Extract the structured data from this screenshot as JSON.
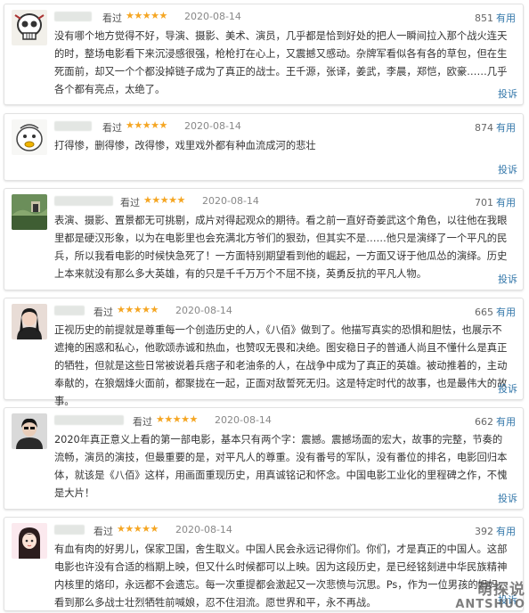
{
  "reviews": [
    {
      "seen": "看过",
      "stars": "★★★★★",
      "date": "2020-08-14",
      "votes": "851",
      "useful": "有用",
      "text": "没有哪个地方觉得不好，导演、摄影、美术、演员，几乎都是恰到好处的把人一瞬间拉入那个战火连天的时，整场电影看下来沉浸感很强，枪枪打在心上，又震撼又感动。杂牌军看似各有各的草包，但在生死面前，却又一个个都没掉链子成为了真正的战士。王千源，张译，姜武，李晨，郑恺，欧豪……几乎各个都有亮点，太绝了。",
      "report": "投诉"
    },
    {
      "seen": "看过",
      "stars": "★★★★★",
      "date": "2020-08-14",
      "votes": "874",
      "useful": "有用",
      "text": "打得惨，删得惨，改得惨，戏里戏外都有种血流成河的悲壮",
      "report": "投诉"
    },
    {
      "seen": "看过",
      "stars": "★★★★★",
      "date": "2020-08-14",
      "votes": "701",
      "useful": "有用",
      "text": "表演、摄影、置景都无可挑剔，成片对得起观众的期待。看之前一直好奇姜武这个角色，以往他在我眼里都是硬汉形象，以为在电影里也会充满北方爷们的狠劲，但其实不是……他只是演绎了一个平凡的民兵，所以我看电影的时候快急死了！一方面特别期望看到他的崛起，一方面又讶于他瓜怂的演绎。历史上本来就没有那么多大英雄，有的只是千千万万个不屈不挠，英勇反抗的平凡人物。",
      "report": "投诉"
    },
    {
      "seen": "看过",
      "stars": "★★★★★",
      "date": "2020-08-14",
      "votes": "665",
      "useful": "有用",
      "text": "正视历史的前提就是尊重每一个创造历史的人，《八佰》做到了。他描写真实的恐惧和胆怯，也展示不遮掩的困惑和私心，他歌颂赤诚和热血，也赞叹无畏和决绝。图安稳日子的普通人尚且不懂什么是真正的牺牲，但就是这些日常被说着兵痞子和老油条的人，在战争中成为了真正的英雄。被动推着的，主动奉献的，在狼烟烽火面前，都聚拢在一起，正面对敌誓死无归。这是特定时代的故事，也是最伟大的故事。",
      "report": "投诉"
    },
    {
      "seen": "看过",
      "stars": "★★★★★",
      "date": "2020-08-14",
      "votes": "662",
      "useful": "有用",
      "text": "2020年真正意义上看的第一部电影，基本只有两个字：震撼。震撼场面的宏大，故事的完整，节奏的流畅，演员的演技，但最重要的是，对平凡人的尊重。没有番号的军队，没有番位的排名，电影回归本体，就该是《八佰》这样，用画面重现历史，用真诚铭记和怀念。中国电影工业化的里程碑之作，不愧是大片！",
      "report": "投诉"
    },
    {
      "seen": "看过",
      "stars": "★★★★★",
      "date": "2020-08-14",
      "votes": "392",
      "useful": "有用",
      "text": "有血有肉的好男儿，保家卫国，舍生取义。中国人民会永远记得你们。你们，才是真正的中国人。这部电影也许没有合适的档期上映，但又什么时候都可以上映。因为这段历史，是已经铭刻进中华民族精神内核里的烙印，永远都不会遗忘。每一次重提都会激起又一次悲愤与沉思。Ps，作为一位男孩的妈妈，看到那么多战士壮烈牺牲前喊娘，忍不住泪流。愿世界和平，永不再战。",
      "report": "投诉"
    }
  ],
  "watermark": {
    "main": "萌探说",
    "sub": "ANTSHUO"
  },
  "colors": {
    "star": "#f5a623",
    "link": "#3377aa"
  }
}
